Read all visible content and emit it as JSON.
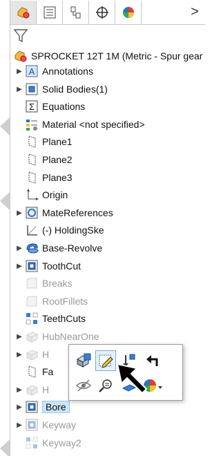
{
  "tabs": [
    {
      "icon": "feature-manager-icon",
      "active": true
    },
    {
      "icon": "property-manager-icon",
      "active": false
    },
    {
      "icon": "configuration-manager-icon",
      "active": false
    },
    {
      "icon": "dimxpert-icon",
      "active": false
    },
    {
      "icon": "display-manager-icon",
      "active": false
    }
  ],
  "tabs_more": ">",
  "root": {
    "label": "SPROCKET 12T 1M (Metric - Spur gear"
  },
  "tree": [
    {
      "label": "Annotations",
      "icon": "annotations-icon",
      "expander": true,
      "dim": false
    },
    {
      "label": "Solid Bodies(1)",
      "icon": "solid-bodies-icon",
      "expander": true,
      "dim": false
    },
    {
      "label": "Equations",
      "icon": "equations-icon",
      "expander": false,
      "dim": false
    },
    {
      "label": "Material <not specified>",
      "icon": "material-icon",
      "expander": false,
      "dim": false
    },
    {
      "label": "Plane1",
      "icon": "plane-icon",
      "expander": false,
      "dim": false
    },
    {
      "label": "Plane2",
      "icon": "plane-icon",
      "expander": false,
      "dim": false
    },
    {
      "label": "Plane3",
      "icon": "plane-icon",
      "expander": false,
      "dim": false
    },
    {
      "label": "Origin",
      "icon": "origin-icon",
      "expander": false,
      "dim": false
    },
    {
      "label": "MateReferences",
      "icon": "mate-references-icon",
      "expander": true,
      "dim": false
    },
    {
      "label": "(-) HoldingSke",
      "icon": "sketch-icon",
      "expander": false,
      "dim": false
    },
    {
      "label": "Base-Revolve",
      "icon": "revolve-icon",
      "expander": true,
      "dim": false
    },
    {
      "label": "ToothCut",
      "icon": "cut-icon",
      "expander": true,
      "dim": false
    },
    {
      "label": "Breaks",
      "icon": "fillet-icon",
      "expander": false,
      "dim": true
    },
    {
      "label": "RootFillets",
      "icon": "fillet-icon",
      "expander": false,
      "dim": true
    },
    {
      "label": "TeethCuts",
      "icon": "pattern-icon",
      "expander": false,
      "dim": false
    },
    {
      "label": "HubNearOne",
      "icon": "extrude-icon",
      "expander": true,
      "dim": true
    },
    {
      "label": "H",
      "icon": "extrude-icon",
      "expander": true,
      "dim": true
    },
    {
      "label": "Fa",
      "icon": "plane-icon",
      "expander": false,
      "dim": false
    },
    {
      "label": "H",
      "icon": "extrude-icon",
      "expander": true,
      "dim": true
    },
    {
      "label": "Bore",
      "icon": "cut-icon",
      "expander": true,
      "dim": false,
      "selected": true
    },
    {
      "label": "Keyway",
      "icon": "cut-icon",
      "expander": true,
      "dim": true
    },
    {
      "label": "Keyway2",
      "icon": "pattern-icon",
      "expander": false,
      "dim": true
    }
  ],
  "context_toolbar": {
    "row1": [
      "feature-properties-icon",
      "edit-sketch-icon",
      "rollback-icon",
      "parent-child-icon"
    ],
    "row2": [
      "hide-icon",
      "zoom-to-selection-icon",
      "normal-to-icon",
      "appearance-icon"
    ]
  },
  "colors": {
    "selection": "#cce4f7",
    "dim_text": "#9a9a9a",
    "accent": "#2e74c0"
  }
}
